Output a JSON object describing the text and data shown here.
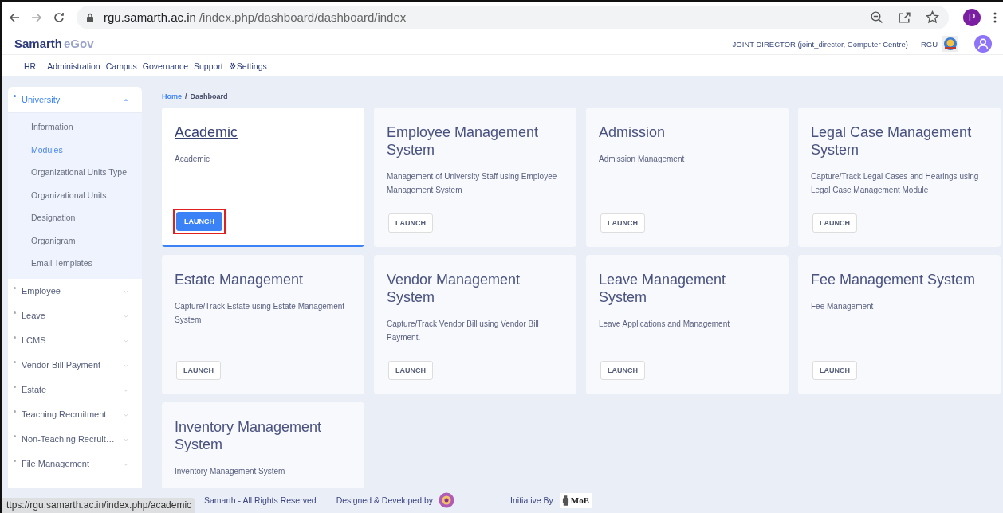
{
  "browser": {
    "url_host": "rgu.samarth.ac.in",
    "url_path": "/index.php/dashboard/dashboard/index",
    "profile": "P"
  },
  "header": {
    "brand_main": "Samarth",
    "brand_sub": "eGov",
    "user": "JOINT DIRECTOR (joint_director, Computer Centre)",
    "org": "RGU"
  },
  "nav": [
    {
      "label": "HR",
      "kind": "text"
    },
    {
      "label": "Administration",
      "kind": "text"
    },
    {
      "label": "Campus",
      "kind": "text"
    },
    {
      "label": "Governance",
      "kind": "text"
    },
    {
      "label": "Support",
      "kind": "text"
    },
    {
      "label": "Settings",
      "kind": "gear"
    }
  ],
  "sidebar": [
    {
      "label": "University",
      "expanded": true,
      "children": [
        {
          "label": "Information",
          "selected": false
        },
        {
          "label": "Modules",
          "selected": true
        },
        {
          "label": "Organizational Units Type",
          "selected": false
        },
        {
          "label": "Organizational Units",
          "selected": false
        },
        {
          "label": "Designation",
          "selected": false
        },
        {
          "label": "Organigram",
          "selected": false
        },
        {
          "label": "Email Templates",
          "selected": false
        }
      ]
    },
    {
      "label": "Employee",
      "expanded": false
    },
    {
      "label": "Leave",
      "expanded": false
    },
    {
      "label": "LCMS",
      "expanded": false
    },
    {
      "label": "Vendor Bill Payment",
      "expanded": false
    },
    {
      "label": "Estate",
      "expanded": false
    },
    {
      "label": "Teaching Recruitment",
      "expanded": false
    },
    {
      "label": "Non-Teaching Recruit…",
      "expanded": false
    },
    {
      "label": "File Management",
      "expanded": false
    }
  ],
  "breadcrumb": {
    "items": [
      "Home",
      "Dashboard"
    ],
    "separator": "/"
  },
  "modules": [
    {
      "title": "Academic",
      "description": "Academic",
      "button": "LAUNCH",
      "selected": true
    },
    {
      "title": "Employee Management System",
      "description": "Management of University Staff using Employee Management System",
      "button": "LAUNCH",
      "selected": false
    },
    {
      "title": "Admission",
      "description": "Admission Management",
      "button": "LAUNCH",
      "selected": false
    },
    {
      "title": "Legal Case Management System",
      "description": "Capture/Track Legal Cases and Hearings using Legal Case Management Module",
      "button": "LAUNCH",
      "selected": false
    },
    {
      "title": "Estate Management",
      "description": "Capture/Track Estate using Estate Management System",
      "button": "LAUNCH",
      "selected": false
    },
    {
      "title": "Vendor Management System",
      "description": "Capture/Track Vendor Bill using Vendor Bill Payment.",
      "button": "LAUNCH",
      "selected": false
    },
    {
      "title": "Leave Management System",
      "description": "Leave Applications and Management",
      "button": "LAUNCH",
      "selected": false
    },
    {
      "title": "Fee Management System",
      "description": "Fee Management",
      "button": "LAUNCH",
      "selected": false
    },
    {
      "title": "Inventory Management System",
      "description": "Inventory Management System",
      "selected": false
    }
  ],
  "footer": {
    "copyright": "Samarth - All Rights Reserved",
    "designed": "Designed & Developed by",
    "initiative": "Initiative By",
    "moe": "MoE"
  },
  "status_url": "ttps://rgu.samarth.ac.in/index.php/academic"
}
